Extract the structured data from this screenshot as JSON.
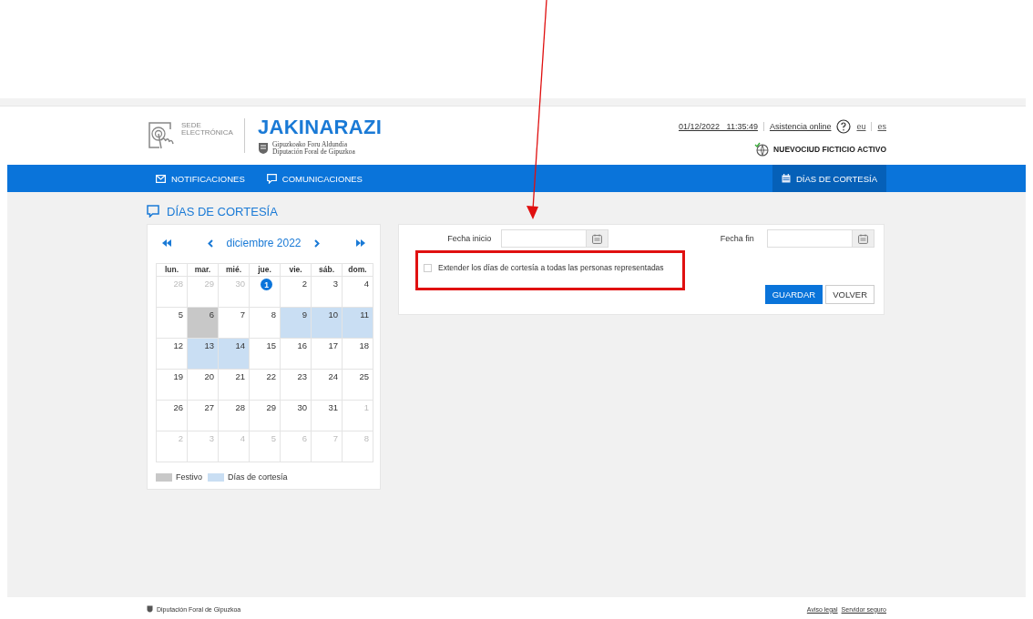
{
  "header": {
    "logo_text_1": "SEDE",
    "logo_text_2": "ELECTRÓNICA",
    "app_title": "JAKINARAZI",
    "org_line_1": "Gipuzkoako Foru Aldundia",
    "org_line_2": "Diputación Foral de Gipuzkoa",
    "datetime": "01/12/2022   11:35:49",
    "assistance_link": "Asistencia online",
    "languages": [
      "eu",
      "es"
    ],
    "user": "NUEVOCIUD FICTICIO ACTIVO"
  },
  "nav": {
    "items": [
      {
        "label": "NOTIFICACIONES",
        "selected": false
      },
      {
        "label": "COMUNICACIONES",
        "selected": false
      }
    ],
    "right_item": {
      "label": "DÍAS DE CORTESÍA",
      "selected": true
    }
  },
  "page_title": "DÍAS DE CORTESÍA",
  "calendar": {
    "month": "diciembre 2022",
    "weekdays": [
      "lun.",
      "mar.",
      "mié.",
      "jue.",
      "vie.",
      "sáb.",
      "dom."
    ],
    "weeks": [
      [
        {
          "day": "28",
          "kind": "other"
        },
        {
          "day": "29",
          "kind": "other"
        },
        {
          "day": "30",
          "kind": "other"
        },
        {
          "day": "1",
          "kind": "today"
        },
        {
          "day": "2",
          "kind": "normal"
        },
        {
          "day": "3",
          "kind": "normal"
        },
        {
          "day": "4",
          "kind": "normal"
        }
      ],
      [
        {
          "day": "5",
          "kind": "normal"
        },
        {
          "day": "6",
          "kind": "holiday"
        },
        {
          "day": "7",
          "kind": "normal"
        },
        {
          "day": "8",
          "kind": "normal"
        },
        {
          "day": "9",
          "kind": "courtesy"
        },
        {
          "day": "10",
          "kind": "courtesy"
        },
        {
          "day": "11",
          "kind": "courtesy"
        }
      ],
      [
        {
          "day": "12",
          "kind": "normal"
        },
        {
          "day": "13",
          "kind": "courtesy"
        },
        {
          "day": "14",
          "kind": "courtesy"
        },
        {
          "day": "15",
          "kind": "normal"
        },
        {
          "day": "16",
          "kind": "normal"
        },
        {
          "day": "17",
          "kind": "normal"
        },
        {
          "day": "18",
          "kind": "normal"
        }
      ],
      [
        {
          "day": "19",
          "kind": "normal"
        },
        {
          "day": "20",
          "kind": "normal"
        },
        {
          "day": "21",
          "kind": "normal"
        },
        {
          "day": "22",
          "kind": "normal"
        },
        {
          "day": "23",
          "kind": "normal"
        },
        {
          "day": "24",
          "kind": "normal"
        },
        {
          "day": "25",
          "kind": "normal"
        }
      ],
      [
        {
          "day": "26",
          "kind": "normal"
        },
        {
          "day": "27",
          "kind": "normal"
        },
        {
          "day": "28",
          "kind": "normal"
        },
        {
          "day": "29",
          "kind": "normal"
        },
        {
          "day": "30",
          "kind": "normal"
        },
        {
          "day": "31",
          "kind": "normal"
        },
        {
          "day": "1",
          "kind": "other"
        }
      ],
      [
        {
          "day": "2",
          "kind": "other"
        },
        {
          "day": "3",
          "kind": "other"
        },
        {
          "day": "4",
          "kind": "other"
        },
        {
          "day": "5",
          "kind": "other"
        },
        {
          "day": "6",
          "kind": "other"
        },
        {
          "day": "7",
          "kind": "other"
        },
        {
          "day": "8",
          "kind": "other"
        }
      ]
    ],
    "legend": [
      {
        "label": "Festivo",
        "color": "#c8c8c8"
      },
      {
        "label": "Días de cortesía",
        "color": "#c9def3"
      }
    ]
  },
  "form": {
    "start_label": "Fecha inicio",
    "end_label": "Fecha fin",
    "extend_checkbox": {
      "label": "Extender los días de cortesía a todas las personas representadas",
      "checked": false
    },
    "buttons": [
      {
        "label": "GUARDAR",
        "kind": "primary"
      },
      {
        "label": "VOLVER",
        "kind": "secondary"
      }
    ]
  },
  "footer": {
    "org": "Diputación Foral de Gipuzkoa",
    "links": [
      "Aviso legal",
      "Servidor seguro"
    ]
  }
}
